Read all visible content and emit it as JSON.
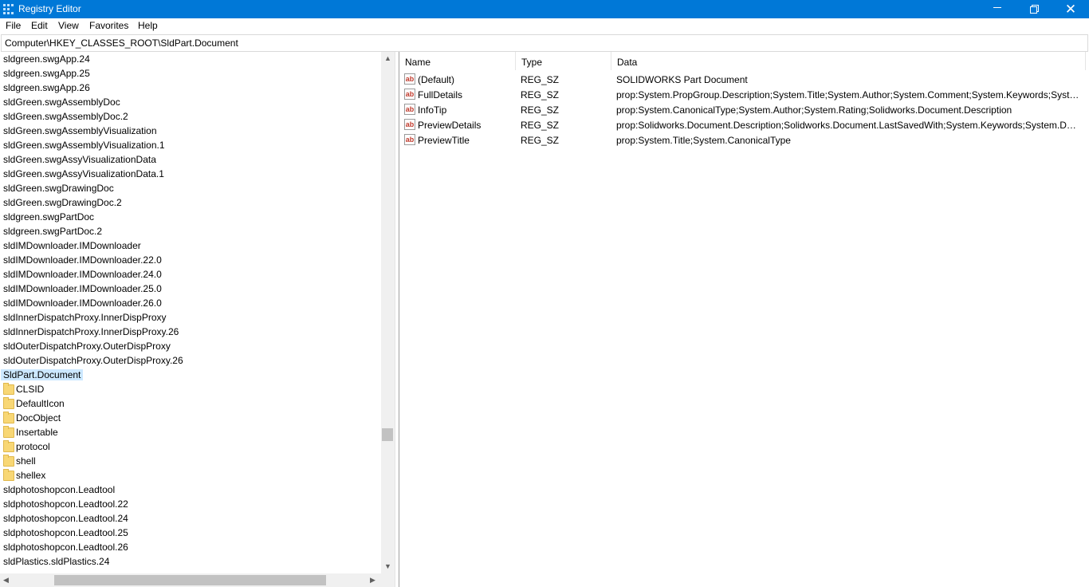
{
  "window": {
    "title": "Registry Editor",
    "icon": "registry-editor-icon",
    "controls": {
      "minimize": "minimize-icon",
      "restore": "restore-icon",
      "close": "✕"
    }
  },
  "menu": [
    "File",
    "Edit",
    "View",
    "Favorites",
    "Help"
  ],
  "address": "Computer\\HKEY_CLASSES_ROOT\\SldPart.Document",
  "tree": {
    "items": [
      {
        "label": "sldgreen.swgApp.24",
        "folder": false
      },
      {
        "label": "sldgreen.swgApp.25",
        "folder": false
      },
      {
        "label": "sldgreen.swgApp.26",
        "folder": false
      },
      {
        "label": "sldGreen.swgAssemblyDoc",
        "folder": false
      },
      {
        "label": "sldGreen.swgAssemblyDoc.2",
        "folder": false
      },
      {
        "label": "sldGreen.swgAssemblyVisualization",
        "folder": false
      },
      {
        "label": "sldGreen.swgAssemblyVisualization.1",
        "folder": false
      },
      {
        "label": "sldGreen.swgAssyVisualizationData",
        "folder": false
      },
      {
        "label": "sldGreen.swgAssyVisualizationData.1",
        "folder": false
      },
      {
        "label": "sldGreen.swgDrawingDoc",
        "folder": false
      },
      {
        "label": "sldGreen.swgDrawingDoc.2",
        "folder": false
      },
      {
        "label": "sldgreen.swgPartDoc",
        "folder": false
      },
      {
        "label": "sldgreen.swgPartDoc.2",
        "folder": false
      },
      {
        "label": "sldIMDownloader.IMDownloader",
        "folder": false
      },
      {
        "label": "sldIMDownloader.IMDownloader.22.0",
        "folder": false
      },
      {
        "label": "sldIMDownloader.IMDownloader.24.0",
        "folder": false
      },
      {
        "label": "sldIMDownloader.IMDownloader.25.0",
        "folder": false
      },
      {
        "label": "sldIMDownloader.IMDownloader.26.0",
        "folder": false
      },
      {
        "label": "sldInnerDispatchProxy.InnerDispProxy",
        "folder": false
      },
      {
        "label": "sldInnerDispatchProxy.InnerDispProxy.26",
        "folder": false
      },
      {
        "label": "sldOuterDispatchProxy.OuterDispProxy",
        "folder": false
      },
      {
        "label": "sldOuterDispatchProxy.OuterDispProxy.26",
        "folder": false
      },
      {
        "label": "SldPart.Document",
        "folder": false,
        "selected": true
      },
      {
        "label": "CLSID",
        "folder": true
      },
      {
        "label": "DefaultIcon",
        "folder": true
      },
      {
        "label": "DocObject",
        "folder": true
      },
      {
        "label": "Insertable",
        "folder": true
      },
      {
        "label": "protocol",
        "folder": true
      },
      {
        "label": "shell",
        "folder": true
      },
      {
        "label": "shellex",
        "folder": true
      },
      {
        "label": "sldphotoshopcon.Leadtool",
        "folder": false
      },
      {
        "label": "sldphotoshopcon.Leadtool.22",
        "folder": false
      },
      {
        "label": "sldphotoshopcon.Leadtool.24",
        "folder": false
      },
      {
        "label": "sldphotoshopcon.Leadtool.25",
        "folder": false
      },
      {
        "label": "sldphotoshopcon.Leadtool.26",
        "folder": false
      },
      {
        "label": "sldPlastics.sldPlastics.24",
        "folder": false
      }
    ]
  },
  "values": {
    "columns": [
      "Name",
      "Type",
      "Data"
    ],
    "icon_text": "ab",
    "rows": [
      {
        "name": "(Default)",
        "type": "REG_SZ",
        "data": "SOLIDWORKS Part Document"
      },
      {
        "name": "FullDetails",
        "type": "REG_SZ",
        "data": "prop:System.PropGroup.Description;System.Title;System.Author;System.Comment;System.Keywords;System..."
      },
      {
        "name": "InfoTip",
        "type": "REG_SZ",
        "data": "prop:System.CanonicalType;System.Author;System.Rating;Solidworks.Document.Description"
      },
      {
        "name": "PreviewDetails",
        "type": "REG_SZ",
        "data": "prop:Solidworks.Document.Description;Solidworks.Document.LastSavedWith;System.Keywords;System.Date..."
      },
      {
        "name": "PreviewTitle",
        "type": "REG_SZ",
        "data": "prop:System.Title;System.CanonicalType"
      }
    ]
  },
  "colors": {
    "titlebar": "#0078d7",
    "selection": "#cce8ff",
    "folder": "#f8d775"
  }
}
